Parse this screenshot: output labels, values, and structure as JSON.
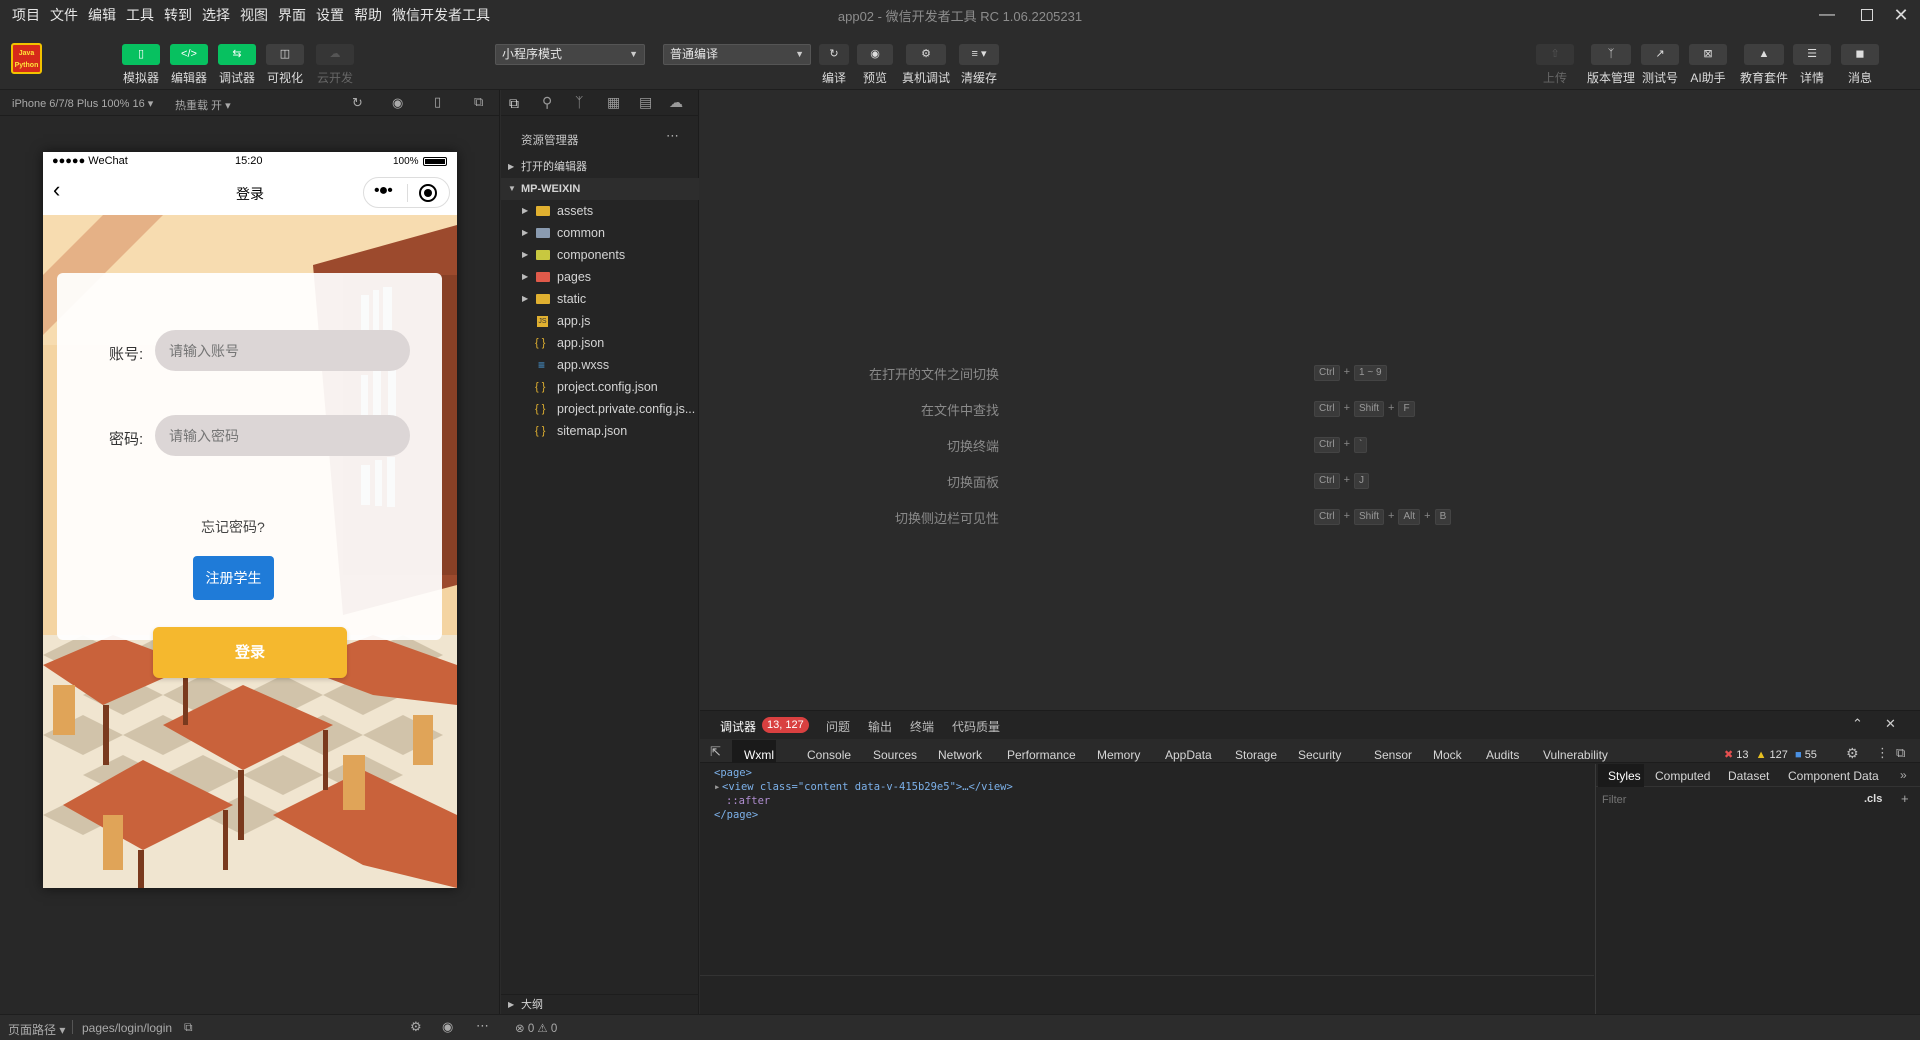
{
  "menu": {
    "items": [
      "项目",
      "文件",
      "编辑",
      "工具",
      "转到",
      "选择",
      "视图",
      "界面",
      "设置",
      "帮助",
      "微信开发者工具"
    ],
    "window_title": "app02 - 微信开发者工具 RC 1.06.2205231"
  },
  "toolbar": {
    "logo_text": "Java Python",
    "left_buttons": [
      {
        "label": "模拟器",
        "icon": "phone-icon",
        "style": "green"
      },
      {
        "label": "编辑器",
        "icon": "code-icon",
        "style": "green"
      },
      {
        "label": "调试器",
        "icon": "debug-icon",
        "style": "green"
      },
      {
        "label": "可视化",
        "icon": "layout-icon",
        "style": "normal"
      },
      {
        "label": "云开发",
        "icon": "cloud-icon",
        "style": "disabled"
      }
    ],
    "mode_select": "小程序模式",
    "compile_select": "普通编译",
    "mid_buttons": [
      {
        "label": "编译",
        "icon": "refresh-icon"
      },
      {
        "label": "预览",
        "icon": "eye-icon"
      },
      {
        "label": "真机调试",
        "icon": "bug-icon"
      },
      {
        "label": "清缓存",
        "icon": "layers-icon"
      }
    ],
    "right_buttons": [
      {
        "label": "上传",
        "icon": "upload-icon",
        "dim": true
      },
      {
        "label": "版本管理",
        "icon": "branch-icon",
        "dim": false
      },
      {
        "label": "测试号",
        "icon": "external-icon",
        "dim": false
      },
      {
        "label": "AI助手",
        "icon": "ai-icon",
        "dim": false
      },
      {
        "label": "教育套件",
        "icon": "graduation-icon",
        "dim": false
      },
      {
        "label": "详情",
        "icon": "menu-icon",
        "dim": false
      },
      {
        "label": "消息",
        "icon": "bell-icon",
        "dim": false
      }
    ]
  },
  "simulator": {
    "device": "iPhone 6/7/8 Plus 100% 16",
    "hot_reload": "热重载 开",
    "status_left": "●●●●● WeChat",
    "status_time": "15:20",
    "status_battery": "100%",
    "nav_title": "登录",
    "form": {
      "account_label": "账号:",
      "account_placeholder": "请输入账号",
      "password_label": "密码:",
      "password_placeholder": "请输入密码",
      "forgot": "忘记密码?",
      "register": "注册学生",
      "login": "登录"
    }
  },
  "explorer": {
    "title": "资源管理器",
    "open_editors": "打开的编辑器",
    "root": "MP-WEIXIN",
    "folders": [
      "assets",
      "common",
      "components",
      "pages",
      "static"
    ],
    "files": [
      "app.js",
      "app.json",
      "app.wxss",
      "project.config.json",
      "project.private.config.js...",
      "sitemap.json"
    ],
    "outline": "大纲"
  },
  "shortcuts": [
    {
      "label": "在打开的文件之间切换",
      "keys": [
        "Ctrl",
        "1 ~ 9"
      ]
    },
    {
      "label": "在文件中查找",
      "keys": [
        "Ctrl",
        "Shift",
        "F"
      ]
    },
    {
      "label": "切换终端",
      "keys": [
        "Ctrl",
        "`"
      ]
    },
    {
      "label": "切换面板",
      "keys": [
        "Ctrl",
        "J"
      ]
    },
    {
      "label": "切换侧边栏可见性",
      "keys": [
        "Ctrl",
        "Shift",
        "Alt",
        "B"
      ]
    }
  ],
  "debugger": {
    "tabs": [
      "调试器",
      "问题",
      "输出",
      "终端",
      "代码质量"
    ],
    "badge": "13, 127",
    "devtools_tabs": [
      "Wxml",
      "Console",
      "Sources",
      "Network",
      "Performance",
      "Memory",
      "AppData",
      "Storage",
      "Security",
      "Sensor",
      "Mock",
      "Audits",
      "Vulnerability"
    ],
    "errors": "13",
    "warnings": "127",
    "infos": "55",
    "code_lines": [
      "<page>",
      "<view class=\"content data-v-415b29e5\">…</view>",
      "::after",
      "</page>"
    ],
    "side_tabs": [
      "Styles",
      "Computed",
      "Dataset",
      "Component Data"
    ],
    "filter_placeholder": "Filter",
    "cls": ".cls"
  },
  "statusbar": {
    "page_path_label": "页面路径",
    "page_path": "pages/login/login",
    "problems": "⊗ 0 ⚠ 0"
  },
  "colors": {
    "accent_green": "#07c160",
    "login_yellow": "#f5b82e",
    "register_blue": "#1f7bd8",
    "error_red": "#d94040"
  }
}
